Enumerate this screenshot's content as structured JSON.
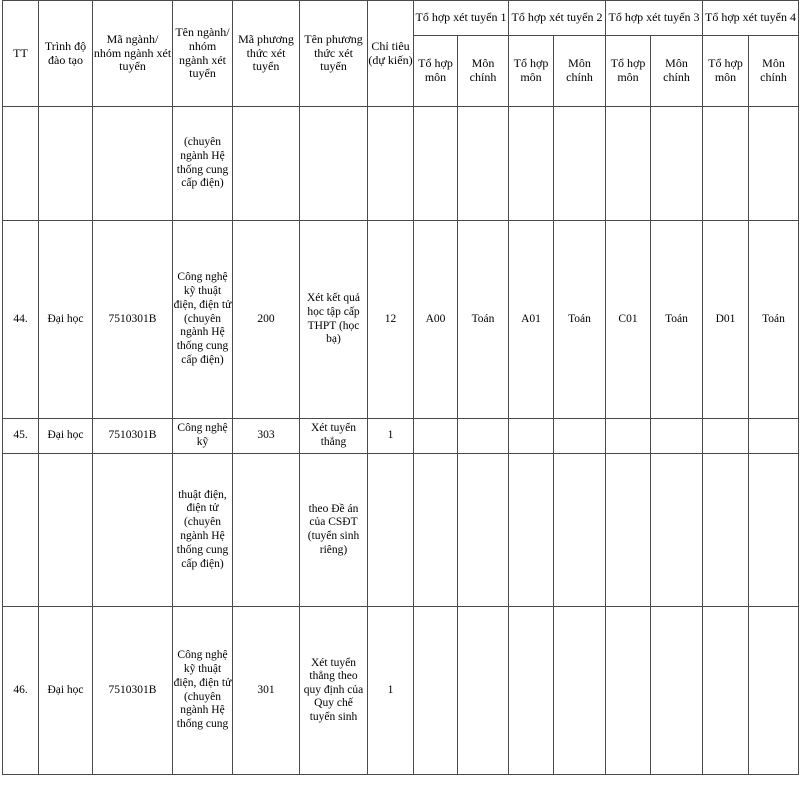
{
  "table": {
    "header": {
      "tt": "TT",
      "level": "Trình độ đào tạo",
      "major_code": "Mã ngành/ nhóm ngành xét tuyển",
      "major_name": "Tên ngành/ nhóm ngành xét tuyển",
      "method_code": "Mã phương thức xét tuyển",
      "method_name": "Tên phương thức xét tuyển",
      "quota": "Chỉ tiêu (dự kiến)",
      "groups": [
        {
          "label": "Tổ hợp xét tuyển 1",
          "combination": "Tổ hợp môn",
          "main_subject": "Môn chính"
        },
        {
          "label": "Tổ hợp xét tuyển 2",
          "combination": "Tổ hợp môn",
          "main_subject": "Môn chính"
        },
        {
          "label": "Tổ hợp xét tuyển 3",
          "combination": "Tổ hợp môn",
          "main_subject": "Môn chính"
        },
        {
          "label": "Tổ hợp xét tuyển 4",
          "combination": "Tổ hợp môn",
          "main_subject": "Môn chính"
        }
      ]
    },
    "rows": [
      {
        "tt": "",
        "level": "",
        "major_code": "",
        "major_name": "(chuyên ngành Hệ thống cung cấp điện)",
        "method_code": "",
        "method_name": "",
        "quota": "",
        "comb1": "",
        "main1": "",
        "comb2": "",
        "main2": "",
        "comb3": "",
        "main3": "",
        "comb4": "",
        "main4": ""
      },
      {
        "tt": "44.",
        "level": "Đại học",
        "major_code": "7510301B",
        "major_name": "Công nghệ kỹ thuật điện, điện tử (chuyên ngành Hệ thống cung cấp điện)",
        "method_code": "200",
        "method_name": "Xét kết quả học tập cấp THPT (học bạ)",
        "quota": "12",
        "comb1": "A00",
        "main1": "Toán",
        "comb2": "A01",
        "main2": "Toán",
        "comb3": "C01",
        "main3": "Toán",
        "comb4": "D01",
        "main4": "Toán"
      },
      {
        "tt": "45.",
        "level": "Đại học",
        "major_code": "7510301B",
        "major_name": "Công nghệ kỹ",
        "method_code": "303",
        "method_name": "Xét tuyển thẳng",
        "quota": "1",
        "comb1": "",
        "main1": "",
        "comb2": "",
        "main2": "",
        "comb3": "",
        "main3": "",
        "comb4": "",
        "main4": ""
      },
      {
        "tt": "",
        "level": "",
        "major_code": "",
        "major_name": "thuật điện, điện tử (chuyên ngành Hệ thống cung cấp điện)",
        "method_code": "",
        "method_name": "theo Đề án của CSĐT (tuyển sinh riêng)",
        "quota": "",
        "comb1": "",
        "main1": "",
        "comb2": "",
        "main2": "",
        "comb3": "",
        "main3": "",
        "comb4": "",
        "main4": ""
      },
      {
        "tt": "46.",
        "level": "Đại học",
        "major_code": "7510301B",
        "major_name": "Công nghệ kỹ thuật điện, điện tử (chuyên ngành Hệ thống cung",
        "method_code": "301",
        "method_name": "Xét tuyển thẳng theo quy định của Quy chế tuyển sinh",
        "quota": "1",
        "comb1": "",
        "main1": "",
        "comb2": "",
        "main2": "",
        "comb3": "",
        "main3": "",
        "comb4": "",
        "main4": ""
      }
    ]
  }
}
